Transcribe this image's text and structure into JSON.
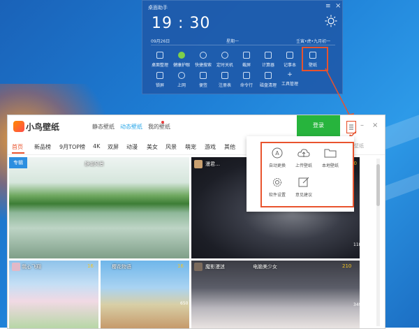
{
  "assistant": {
    "title": "桌面助手",
    "time": "19 : 30",
    "date": "09月26日",
    "weekday": "星期一",
    "lunar": "壬寅•虎•九月初一",
    "tools_row1": [
      {
        "label": "桌面整理",
        "icon": "desktop-icon"
      },
      {
        "label": "健康护眼",
        "icon": "eye-icon"
      },
      {
        "label": "快捷搜索",
        "icon": "search-icon"
      },
      {
        "label": "定时关机",
        "icon": "power-icon"
      },
      {
        "label": "截屏",
        "icon": "crop-icon"
      },
      {
        "label": "计算器",
        "icon": "calculator-icon"
      },
      {
        "label": "记事本",
        "icon": "notepad-icon"
      },
      {
        "label": "壁纸",
        "icon": "wallpaper-icon"
      }
    ],
    "tools_row2": [
      {
        "label": "锁屏",
        "icon": "lock-icon"
      },
      {
        "label": "上网",
        "icon": "globe-icon"
      },
      {
        "label": "便签",
        "icon": "sticky-note-icon"
      },
      {
        "label": "注册表",
        "icon": "registry-icon"
      },
      {
        "label": "命令行",
        "icon": "terminal-icon"
      },
      {
        "label": "磁盘清理",
        "icon": "disk-icon"
      },
      {
        "label": "工具管理",
        "icon": "plus-icon"
      }
    ]
  },
  "app": {
    "logo_text": "小鸟壁纸",
    "tabs": [
      "静态壁纸",
      "动态壁纸",
      "我的壁纸"
    ],
    "active_tab": "动态壁纸",
    "login_label": "登录",
    "categories": [
      "首页",
      "新品榜",
      "9月TOP榜",
      "4K",
      "双屏",
      "动漫",
      "美女",
      "风景",
      "萌宠",
      "游戏",
      "其他"
    ],
    "active_category": "首页",
    "search_fragment": "壁纸",
    "tiles": [
      {
        "tag": "专辑",
        "caption": "静湖风景"
      },
      {
        "caption": "漫君…",
        "likes": "40",
        "side": [
          "118"
        ]
      },
      {
        "caption": "我心飞翔",
        "likes": "16"
      },
      {
        "caption": "樱花物语",
        "likes": "16",
        "side": [
          "650"
        ]
      },
      {
        "caption": "魔影漫迷",
        "caption2": "电脑美少女",
        "likes": "210",
        "side": [
          "349"
        ]
      }
    ],
    "popup_items": [
      {
        "label": "自动更换",
        "icon": "auto-change-icon"
      },
      {
        "label": "上传壁纸",
        "icon": "upload-cloud-icon"
      },
      {
        "label": "本地壁纸",
        "icon": "folder-icon"
      },
      {
        "label": "软件设置",
        "icon": "settings-gear-icon"
      },
      {
        "label": "意见建议",
        "icon": "feedback-edit-icon"
      }
    ]
  },
  "colors": {
    "accent_red": "#e8532d",
    "login_green": "#27b43d",
    "tab_blue": "#28a6e8",
    "tag_blue": "#2c8fe0"
  }
}
